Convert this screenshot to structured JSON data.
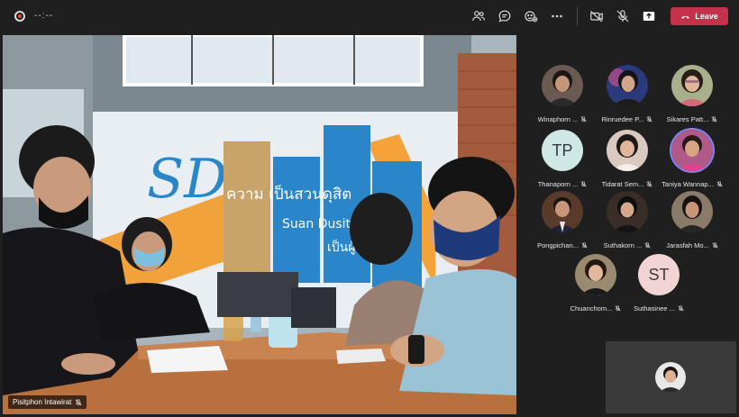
{
  "topbar": {
    "timer": "--:--",
    "leave_label": "Leave",
    "icons": [
      "record-icon",
      "participants-icon",
      "chat-icon",
      "reactions-icon",
      "more-icon",
      "camera-off-icon",
      "mic-off-icon",
      "share-icon",
      "phone-hangup-icon"
    ],
    "leave_color": "#c4314b"
  },
  "main": {
    "speaker_name": "Pisitphon Intawirat",
    "sign_text": "ความ  เป็นสวนดุสิต",
    "sign_sub": "Suan Dusit",
    "sign_sub2": "เป็นผู้น"
  },
  "participants": [
    {
      "name": "Winaphorn ...",
      "type": "photo",
      "bg": "#6b5a52"
    },
    {
      "name": "Rinruedee P...",
      "type": "photo",
      "bg": "#2b3a7a"
    },
    {
      "name": "Sikares Patt...",
      "type": "photo",
      "bg": "#a7b08a"
    },
    {
      "name": "Thanaporn ...",
      "type": "initials",
      "initials": "TP",
      "bg": "#cfe8e6"
    },
    {
      "name": "Tidarat Sem...",
      "type": "photo",
      "bg": "#d9c9c0"
    },
    {
      "name": "Taniya Wannap...",
      "type": "photo",
      "bg": "#b05a8a",
      "active": true
    },
    {
      "name": "Pongpichan...",
      "type": "photo",
      "bg": "#5a3a2a"
    },
    {
      "name": "Suthakorn ...",
      "type": "photo",
      "bg": "#3a2d28"
    },
    {
      "name": "Jarasfah Mo...",
      "type": "photo",
      "bg": "#8a7a6a"
    },
    {
      "name": "Chuanchom...",
      "type": "photo",
      "bg": "#9a8a70"
    },
    {
      "name": "Suthasinee ...",
      "type": "initials",
      "initials": "ST",
      "bg": "#f2d4d4"
    }
  ]
}
